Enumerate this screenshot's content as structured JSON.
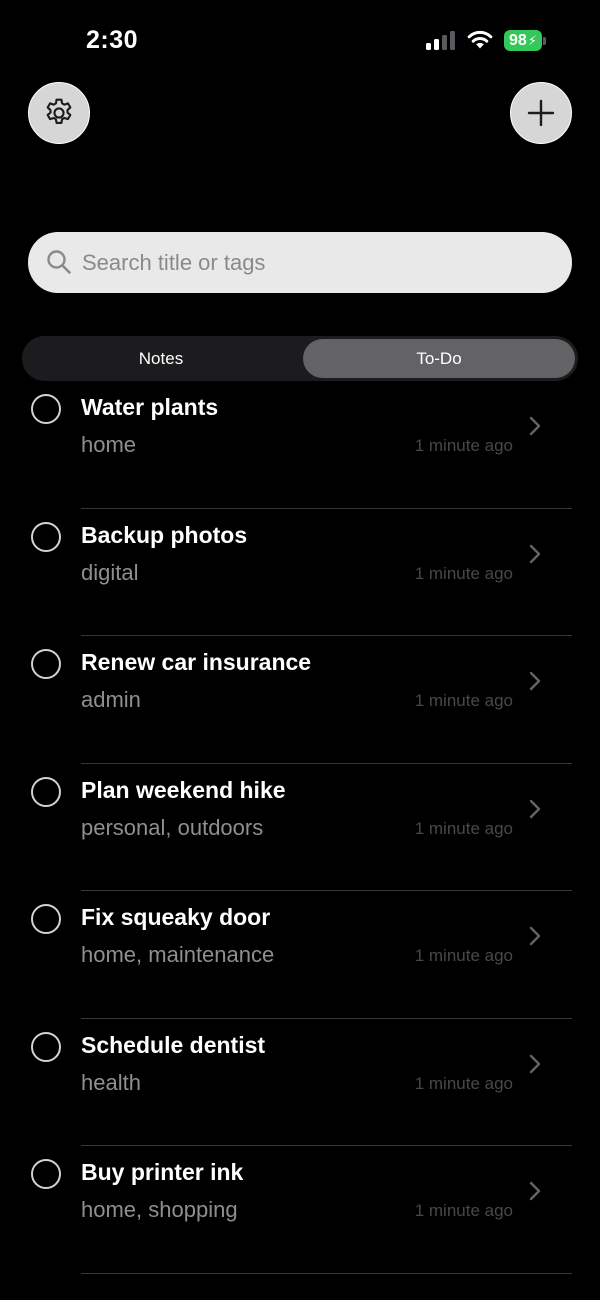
{
  "status_bar": {
    "time": "2:30",
    "battery_level": "98",
    "battery_color": "#34c759",
    "signal_icon": "cellular-signal-icon",
    "wifi_icon": "wifi-icon"
  },
  "header": {
    "settings_icon": "gear-icon",
    "add_icon": "plus-icon"
  },
  "search": {
    "placeholder": "Search title or tags",
    "value": ""
  },
  "segments": {
    "options": [
      "Notes",
      "To-Do"
    ],
    "selected": "To-Do"
  },
  "todos": [
    {
      "title": "Water plants",
      "tags": "home",
      "time": "1 minute ago"
    },
    {
      "title": "Backup photos",
      "tags": "digital",
      "time": "1 minute ago"
    },
    {
      "title": "Renew car insurance",
      "tags": "admin",
      "time": "1 minute ago"
    },
    {
      "title": "Plan weekend hike",
      "tags": "personal, outdoors",
      "time": "1 minute ago"
    },
    {
      "title": "Fix squeaky door",
      "tags": "home, maintenance",
      "time": "1 minute ago"
    },
    {
      "title": "Schedule dentist",
      "tags": "health",
      "time": "1 minute ago"
    },
    {
      "title": "Buy printer ink",
      "tags": "home, shopping",
      "time": "1 minute ago"
    }
  ],
  "colors": {
    "background": "#000000",
    "segment_selected": "#636366",
    "segment_track": "#1c1c1e",
    "search_background": "#e9e9ea",
    "secondary_text": "#8e8e93"
  }
}
